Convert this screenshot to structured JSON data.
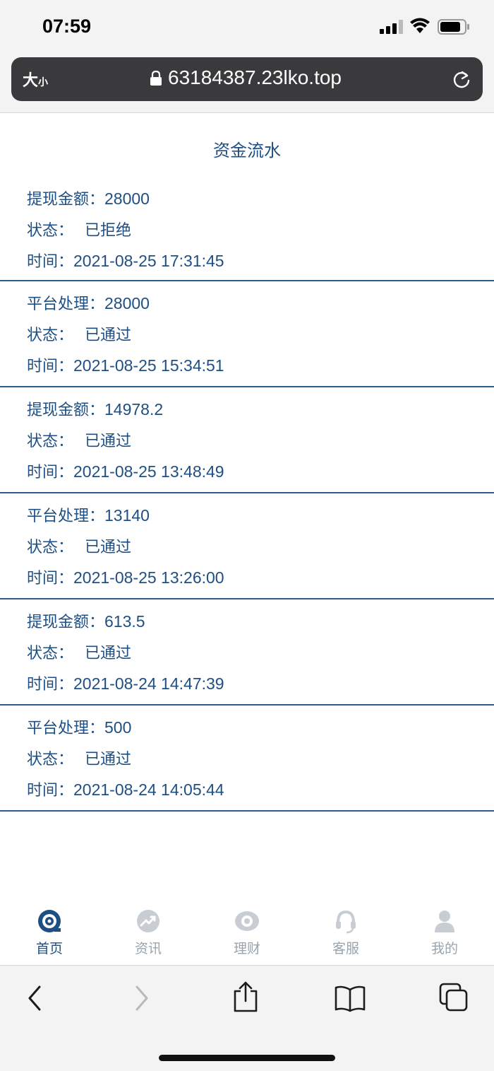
{
  "status_bar": {
    "time": "07:59"
  },
  "browser": {
    "text_size_label_big": "大",
    "text_size_label_small": "小",
    "url": "63184387.23lko.top"
  },
  "page": {
    "title": "资金流水"
  },
  "records": [
    {
      "type_label": "提现金额：",
      "amount": "28000",
      "status_label": "状态：",
      "status": "已拒绝",
      "time_label": "时间：",
      "time": "2021-08-25 17:31:45"
    },
    {
      "type_label": "平台处理：",
      "amount": "28000",
      "status_label": "状态：",
      "status": "已通过",
      "time_label": "时间：",
      "time": "2021-08-25 15:34:51"
    },
    {
      "type_label": "提现金额：",
      "amount": "14978.2",
      "status_label": "状态：",
      "status": "已通过",
      "time_label": "时间：",
      "time": "2021-08-25 13:48:49"
    },
    {
      "type_label": "平台处理：",
      "amount": "13140",
      "status_label": "状态：",
      "status": "已通过",
      "time_label": "时间：",
      "time": "2021-08-25 13:26:00"
    },
    {
      "type_label": "提现金额：",
      "amount": "613.5",
      "status_label": "状态：",
      "status": "已通过",
      "time_label": "时间：",
      "time": "2021-08-24 14:47:39"
    },
    {
      "type_label": "平台处理：",
      "amount": "500",
      "status_label": "状态：",
      "status": "已通过",
      "time_label": "时间：",
      "time": "2021-08-24 14:05:44"
    }
  ],
  "tabs": [
    {
      "label": "首页",
      "icon": "home-icon",
      "active": true
    },
    {
      "label": "资讯",
      "icon": "news-icon",
      "active": false
    },
    {
      "label": "理财",
      "icon": "finance-icon",
      "active": false
    },
    {
      "label": "客服",
      "icon": "support-icon",
      "active": false
    },
    {
      "label": "我的",
      "icon": "profile-icon",
      "active": false
    }
  ],
  "colors": {
    "accent": "#1e4f84",
    "tab_inactive": "#9aa4ad",
    "url_bar_bg": "#3a3a3c"
  }
}
